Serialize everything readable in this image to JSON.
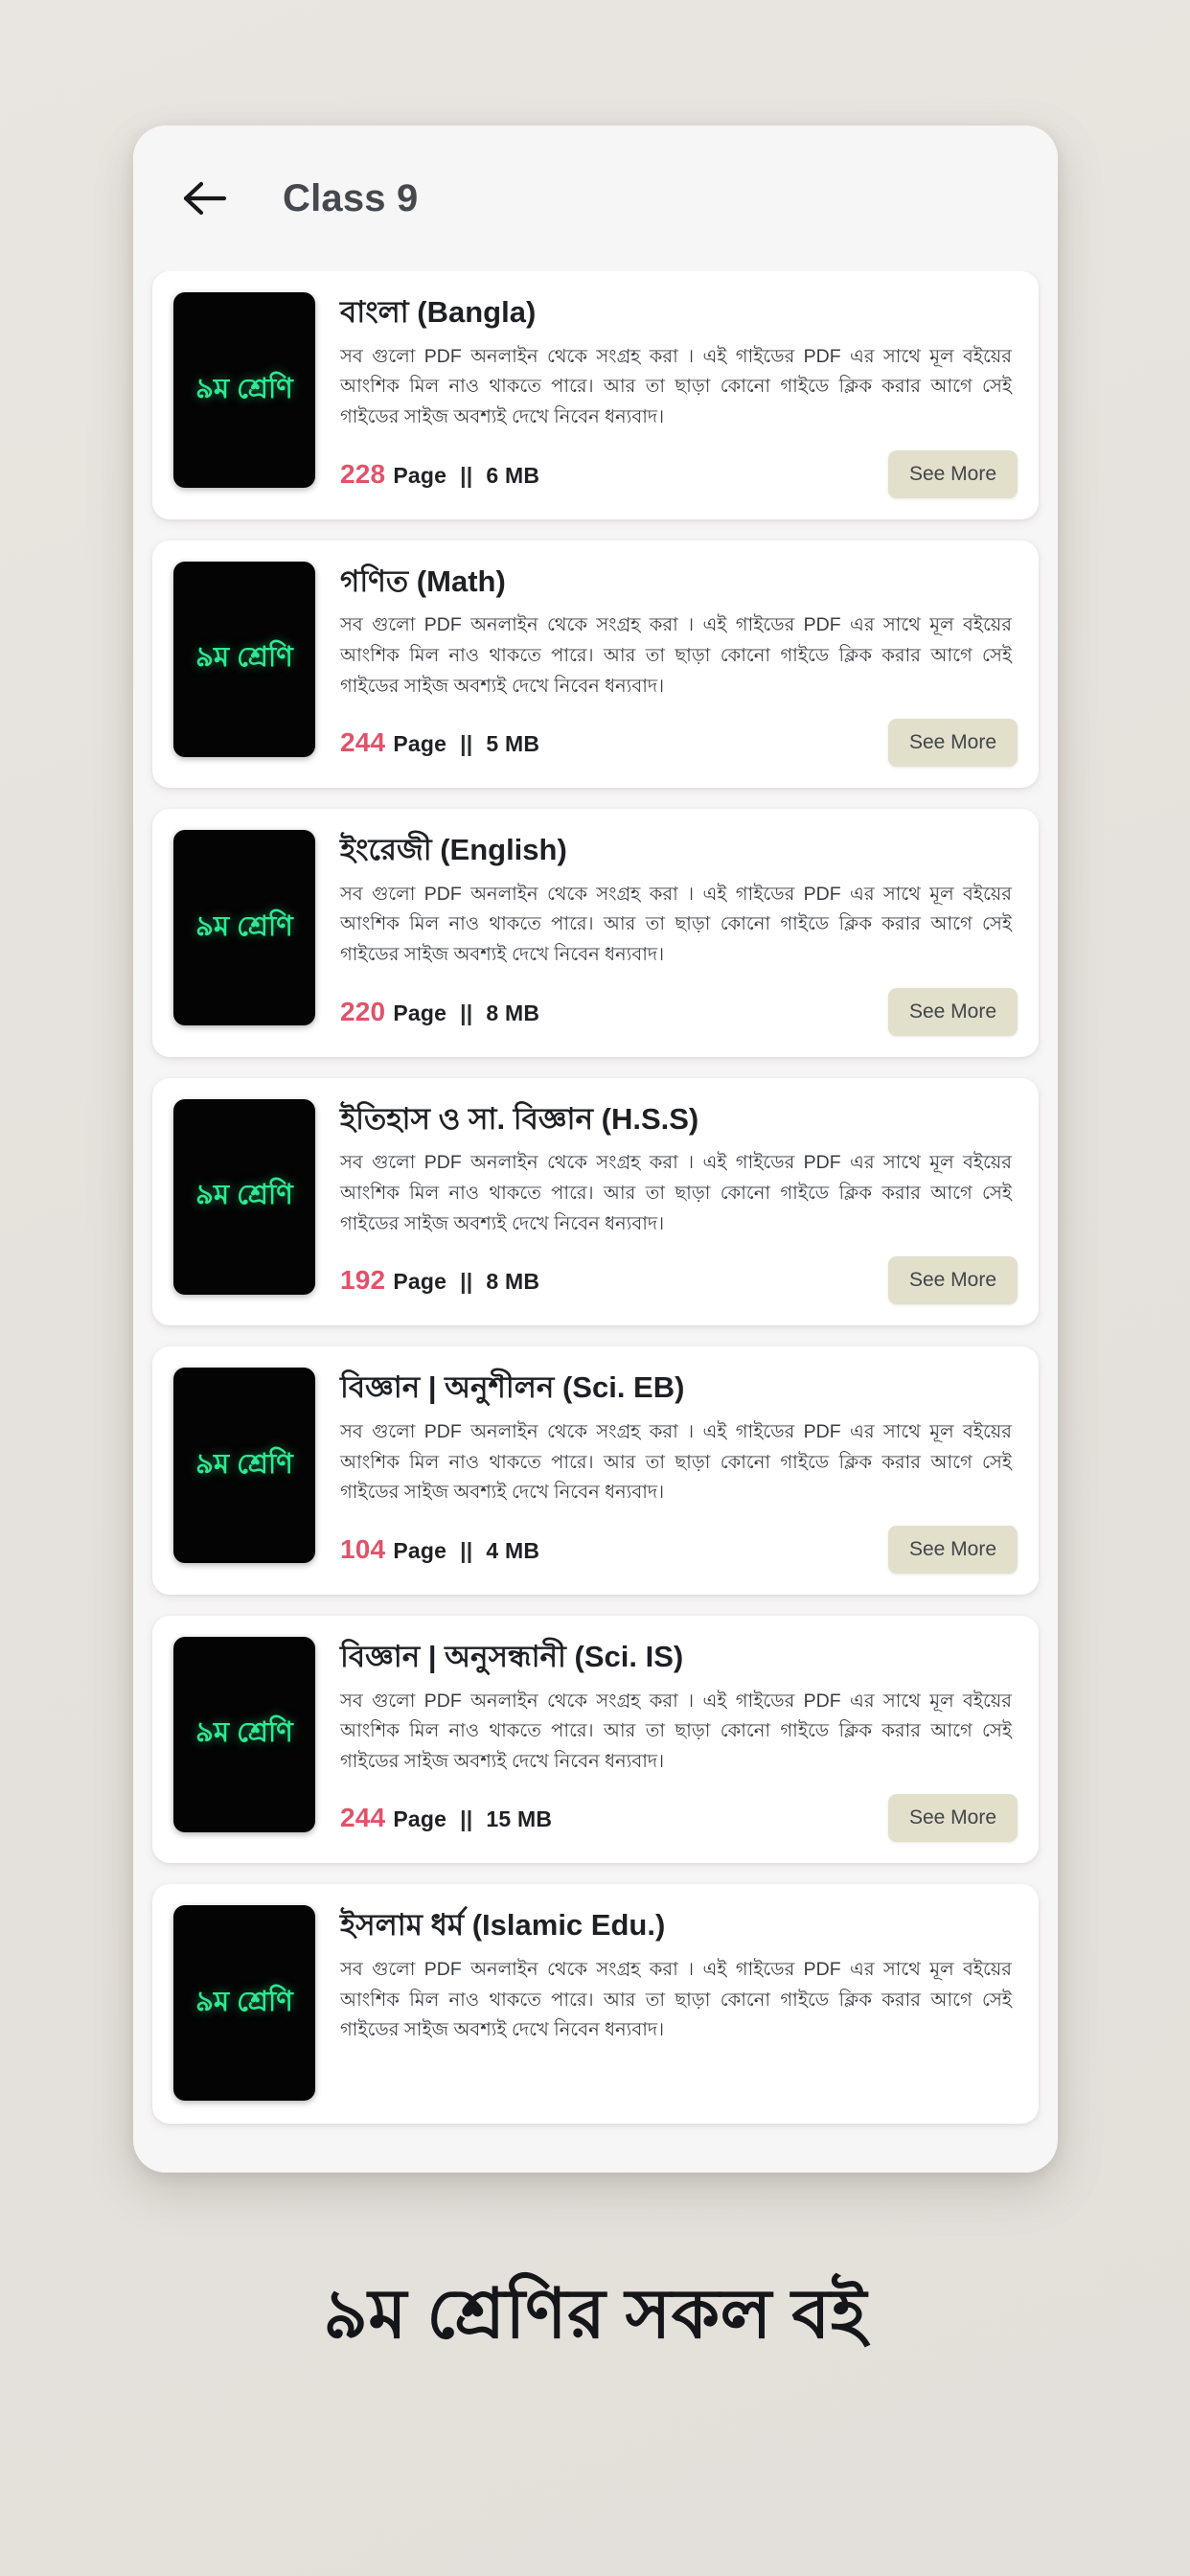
{
  "appbar": {
    "back_icon": "arrow-left-icon",
    "title": "Class 9"
  },
  "common": {
    "description": "সব গুলো PDF অনলাইন থেকে সংগ্রহ করা । এই গাইডের PDF এর সাথে মূল বইয়ের আংশিক মিল নাও থাকতে পারে। আর তা ছাড়া কোনো গাইডে ক্লিক করার আগে সেই গাইডের সাইজ অবশ্যই দেখে নিবেন ধন্যবাদ।",
    "thumb_label": "৯ম শ্রেণি",
    "see_more_label": "See More",
    "page_unit": "Page",
    "separator": "||"
  },
  "colors": {
    "page_count": "#e2526a",
    "thumb_text": "#2fe892",
    "thumb_bg": "#040404",
    "see_more_bg": "#e2dfcb",
    "card_bg": "#ffffff",
    "app_bg": "#f7f6f6",
    "backdrop": "#e6e2dd",
    "title_text": "#1e2024"
  },
  "books": [
    {
      "title": "বাংলা (Bangla)",
      "pages": "228",
      "size": "6 MB"
    },
    {
      "title": "গণিত (Math)",
      "pages": "244",
      "size": "5 MB"
    },
    {
      "title": "ইংরেজী (English)",
      "pages": "220",
      "size": "8 MB"
    },
    {
      "title": "ইতিহাস ও সা. বিজ্ঞান (H.S.S)",
      "pages": "192",
      "size": "8 MB"
    },
    {
      "title": "বিজ্ঞান | অনুশীলন (Sci. EB)",
      "pages": "104",
      "size": "4 MB"
    },
    {
      "title": "বিজ্ঞান | অনুসন্ধানী (Sci. IS)",
      "pages": "244",
      "size": "15 MB"
    },
    {
      "title": "ইসলাম ধর্ম (Islamic Edu.)",
      "pages": "",
      "size": ""
    }
  ],
  "caption": "৯ম শ্রেণির সকল বই"
}
